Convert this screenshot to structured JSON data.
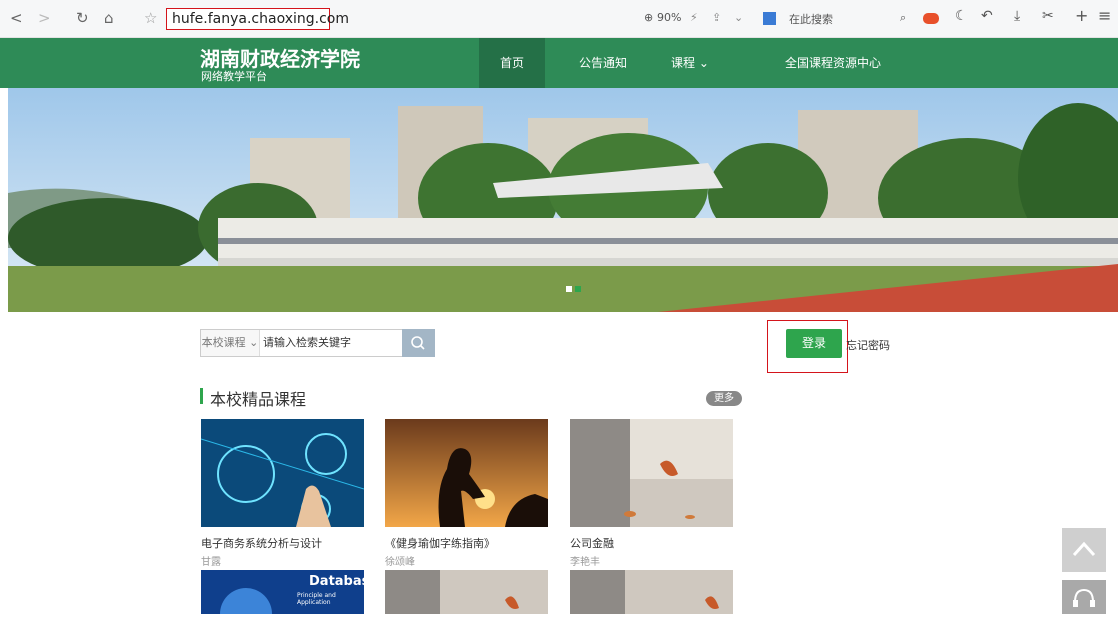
{
  "browser": {
    "address": "hufe.fanya.chaoxing.com",
    "zoom": "90%",
    "search_label": "在此搜索"
  },
  "header": {
    "school_name": "湖南财政经济学院",
    "platform_name": "网络教学平台",
    "nav": [
      "首页",
      "公告通知",
      "课程",
      "全国课程资源中心"
    ]
  },
  "search": {
    "scope": "本校课程",
    "placeholder": "请输入检索关键字"
  },
  "login": {
    "button": "登录",
    "forgot": "忘记密码"
  },
  "section": {
    "title": "本校精品课程",
    "more": "更多"
  },
  "courses": [
    {
      "title": "电子商务系统分析与设计",
      "author": "甘露"
    },
    {
      "title": "《健身瑜伽字练指南》",
      "author": "徐颂峰"
    },
    {
      "title": "公司金融",
      "author": "李艳丰"
    }
  ],
  "row2": {
    "database_title": "Database",
    "database_subtitle": "Principle and Application"
  },
  "colors": {
    "header_green": "#2e8b57",
    "login_green": "#2ea54d",
    "highlight_red": "#d4141b"
  }
}
